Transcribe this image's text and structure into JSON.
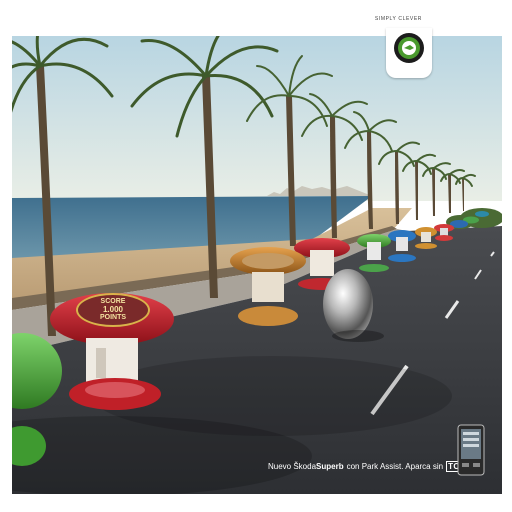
{
  "header": {
    "tagline": "SIMPLY CLEVER",
    "logo": {
      "icon": "skoda-logo-icon",
      "wordmark": "ŠKODA"
    }
  },
  "scene": {
    "description_icon": "beach-road-pinball-scene",
    "bumper_badge": {
      "line1": "SCORE",
      "line2": "1.000",
      "line3": "POINTS"
    },
    "colors": {
      "sky": "#cfe3ea",
      "sea": "#4b7f9a",
      "sand": "#c9ad86",
      "road": "#3a3c40",
      "palm": "#3f5a2c",
      "skoda_green": "#4a9a2e"
    }
  },
  "caption": {
    "prefix": "Nuevo Škoda",
    "model": "Superb",
    "middle": "con Park Assist. Aparca sin",
    "tojng": "TOJNG"
  },
  "device": {
    "icon": "phone-device-icon"
  }
}
